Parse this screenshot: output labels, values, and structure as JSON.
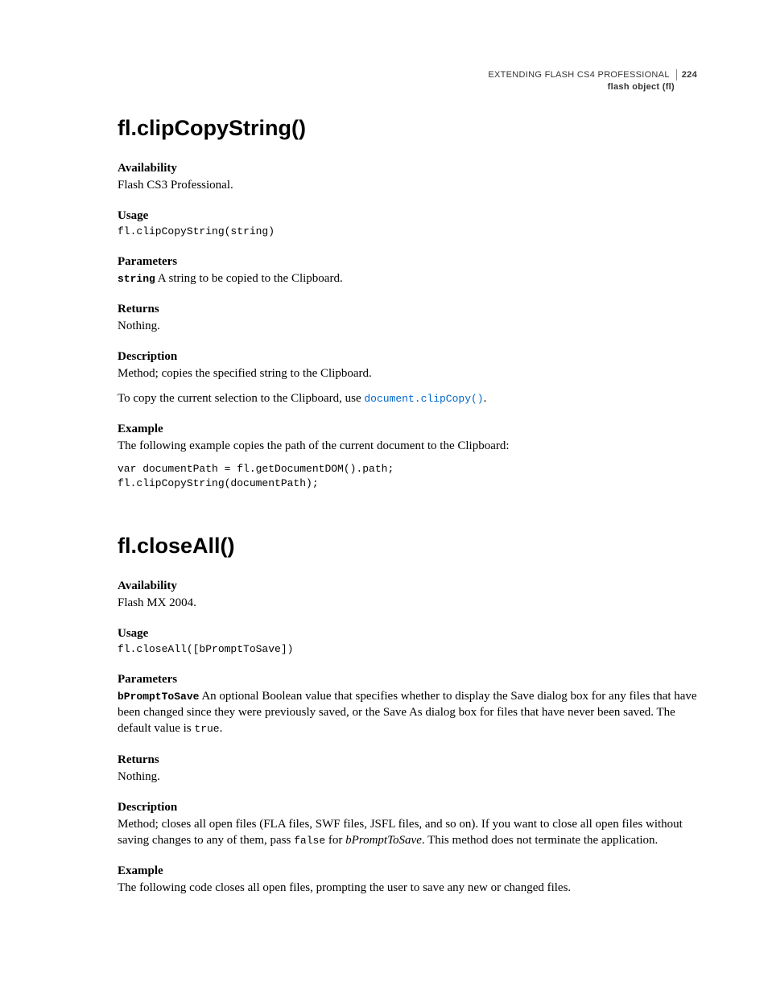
{
  "header": {
    "doc_title": "EXTENDING FLASH CS4 PROFESSIONAL",
    "page_number": "224",
    "section": "flash object (fl)"
  },
  "section1": {
    "title": "fl.clipCopyString()",
    "availability_head": "Availability",
    "availability_text": "Flash CS3 Professional.",
    "usage_head": "Usage",
    "usage_code": "fl.clipCopyString(string)",
    "parameters_head": "Parameters",
    "param_name": "string",
    "param_desc": "  A string to be copied to the Clipboard.",
    "returns_head": "Returns",
    "returns_text": "Nothing.",
    "description_head": "Description",
    "description_text": "Method; copies the specified string to the Clipboard.",
    "description_text2_pre": "To copy the current selection to the Clipboard, use ",
    "description_link": "document.clipCopy()",
    "description_text2_post": ".",
    "example_head": "Example",
    "example_text": "The following example copies the path of the current document to the Clipboard:",
    "example_code": "var documentPath = fl.getDocumentDOM().path;\nfl.clipCopyString(documentPath);"
  },
  "section2": {
    "title": "fl.closeAll()",
    "availability_head": "Availability",
    "availability_text": "Flash MX 2004.",
    "usage_head": "Usage",
    "usage_code": "fl.closeAll([bPromptToSave])",
    "parameters_head": "Parameters",
    "param_name": "bPromptToSave",
    "param_desc_pre": "  An optional Boolean value that specifies whether to display the Save dialog box for any files that have been changed since they were previously saved, or the Save As dialog box for files that have never been saved. The default value is ",
    "param_desc_code": "true",
    "param_desc_post": ".",
    "returns_head": "Returns",
    "returns_text": "Nothing.",
    "description_head": "Description",
    "description_text_pre": "Method; closes all open files (FLA files, SWF files, JSFL files, and so on). If you want to close all open files without saving changes to any of them, pass ",
    "description_code": "false",
    "description_text_mid": " for ",
    "description_param": "bPromptToSave",
    "description_text_post": ". This method does not terminate the application.",
    "example_head": "Example",
    "example_text": "The following code closes all open files, prompting the user to save any new or changed files."
  }
}
